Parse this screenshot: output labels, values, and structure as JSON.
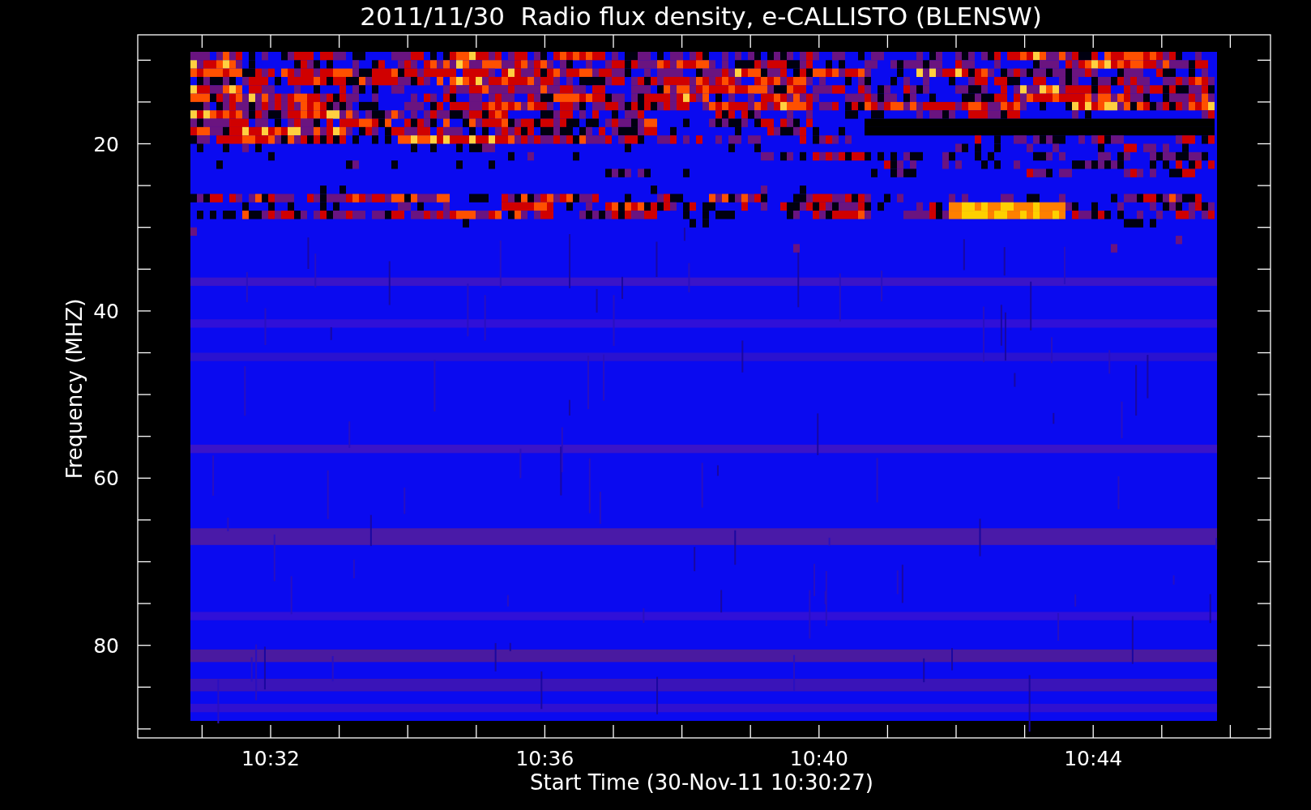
{
  "title": "2011/11/30  Radio flux density, e-CALLISTO (BLENSW)",
  "x_axis": {
    "label": "Start Time (30-Nov-11 10:30:27)",
    "ticks": [
      "10:32",
      "10:36",
      "10:40",
      "10:44"
    ]
  },
  "y_axis": {
    "label": "Frequency (MHZ)",
    "ticks": [
      "20",
      "40",
      "60",
      "80"
    ]
  }
}
